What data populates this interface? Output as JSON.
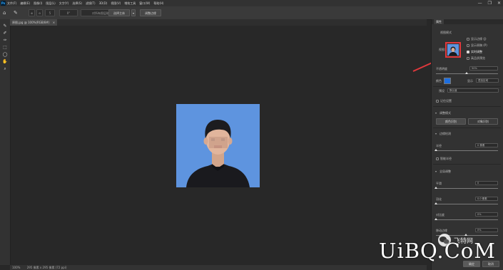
{
  "app": {
    "logo": "Ps"
  },
  "menubar": {
    "items": [
      "文件(F)",
      "编辑(E)",
      "图像(I)",
      "图层(L)",
      "文字(Y)",
      "选择(S)",
      "滤镜(T)",
      "3D(D)",
      "视图(V)",
      "增效工具",
      "窗口(W)",
      "帮助(H)"
    ],
    "minimize": "—",
    "restore": "❐",
    "close": "✕"
  },
  "optionsbar": {
    "size_value": "5",
    "angle_value": "0°",
    "sample_all_label": "对所有图层取样",
    "select_subject_label": "选择主体",
    "select_mask_label": "调整边缘"
  },
  "document": {
    "tab_title": "原图.jpg @ 100%(RGB/8#)",
    "tab_close": "×"
  },
  "statusbar": {
    "zoom": "100%",
    "info": "295 像素 x 295 像素 (72 ppi)"
  },
  "panel": {
    "tab": "属性",
    "view_mode_title": "视图模式",
    "view_label": "视图:",
    "show_edge": "显示边缘 (J)",
    "show_original": "显示原稿 (P)",
    "realtime_adjust": "实时调整",
    "hq_preview": "高品质预览",
    "opacity_label": "不透明度",
    "opacity_value": "50%",
    "color_label": "颜色",
    "display_label": "显示",
    "display_value": "叠加区域",
    "preset_label": "预设",
    "preset_value": "默认值",
    "remember_label": "记住设置",
    "refine_mode_title": "调整模式",
    "color_aware": "颜色识别",
    "object_aware": "对象识别",
    "edge_detect_title": "边缘检测",
    "radius_label": "半径",
    "radius_value": "0 像素",
    "smart_radius": "智能半径",
    "global_refine_title": "全局调整",
    "smooth_label": "平滑",
    "smooth_value": "0",
    "feather_label": "羽化",
    "feather_value": "0.0 像素",
    "contrast_label": "对比度",
    "contrast_value": "0%",
    "shift_edge_label": "移动边缘",
    "shift_edge_value": "0%",
    "ok_label": "确定",
    "cancel_label": "取消"
  },
  "watermark": {
    "brand": "UiBQ.CoM",
    "wechat_name": "飞特网"
  },
  "colors": {
    "photo_background": "#5e94df",
    "highlight_box": "#e0383c",
    "accent_swatch": "#1e6fe0",
    "panel_bg": "#323232"
  }
}
